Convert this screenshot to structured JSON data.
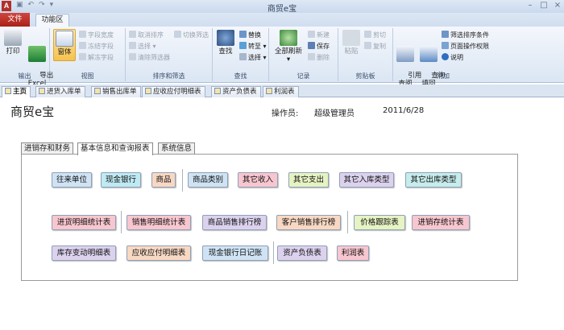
{
  "window": {
    "title": "商贸e宝"
  },
  "ribbon": {
    "file_tab": "文件",
    "active_tab": "功能区",
    "groups": {
      "output": {
        "label": "输出",
        "print": "打印",
        "export": "导出\nExcel"
      },
      "view": {
        "label": "视图",
        "window": "窗体",
        "field_width": "字段宽度",
        "freeze": "冻结字段",
        "unfreeze": "解冻字段"
      },
      "sort": {
        "label": "排序和筛选",
        "cancel_sort": "取消排序",
        "toggle_filter": "切换筛选",
        "select": "选择",
        "clear_filter": "清除筛选器"
      },
      "find": {
        "label": "查找",
        "find": "查找",
        "replace": "替换",
        "goto": "转至",
        "select": "选择"
      },
      "records": {
        "label": "记录",
        "refresh_all": "全部刷新",
        "new": "新建",
        "save": "保存",
        "delete": "删除"
      },
      "clipboard": {
        "label": "剪贴板",
        "paste": "粘贴",
        "cut": "剪切",
        "copy": "复制"
      },
      "extra": {
        "label": "附加",
        "quote": "引用\n查阅",
        "fill": "查询\n填回",
        "filter_cond": "筛选排序条件",
        "page_perm": "页面操作权限",
        "help": "说明"
      }
    }
  },
  "doc_tabs": [
    "主页",
    "进货入库单",
    "销售出库单",
    "应收应付明细表",
    "资产负债表",
    "利润表"
  ],
  "form": {
    "title": "商贸e宝",
    "operator_label": "操作员:",
    "operator": "超级管理员",
    "date": "2011/6/28",
    "page_tabs": [
      "进销存和财务",
      "基本信息和查询报表",
      "系统信息"
    ],
    "active_page": "基本信息和查询报表",
    "rows": [
      [
        "往来单位",
        "现金银行",
        "商品",
        "商品类别",
        "其它收入",
        "其它支出",
        "其它入库类型",
        "其它出库类型"
      ],
      [
        "进货明细统计表",
        "销售明细统计表",
        "商品销售排行榜",
        "客户销售排行榜",
        "价格跟踪表",
        "进销存统计表"
      ],
      [
        "库存变动明细表",
        "应收应付明细表",
        "现金银行日记账",
        "资产负债表",
        "利润表"
      ]
    ]
  }
}
